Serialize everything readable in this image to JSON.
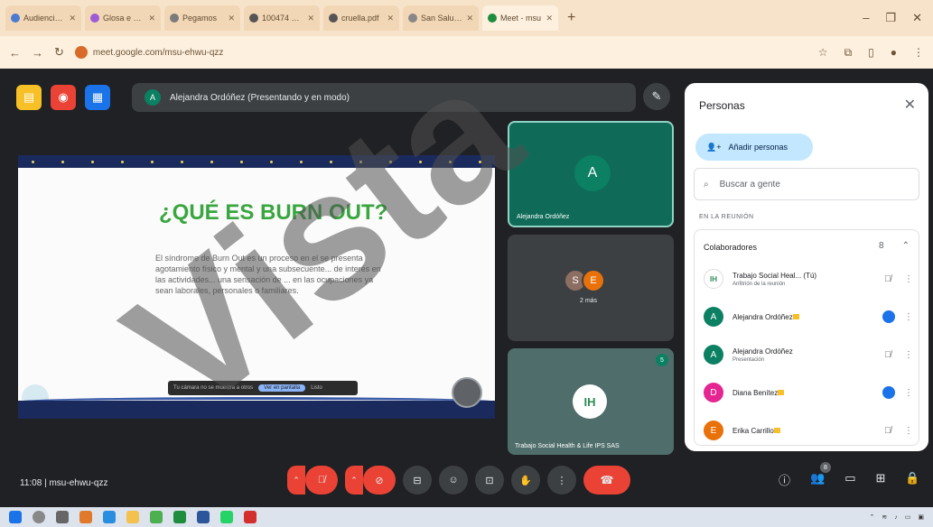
{
  "browser": {
    "tabs": [
      {
        "label": "Audiencia WP",
        "color": "#4a7bd1"
      },
      {
        "label": "Glosa e & ojos",
        "color": "#9b5cd6"
      },
      {
        "label": "Pegamos",
        "color": "#7b7b7b"
      },
      {
        "label": "100474 89878",
        "color": "#555"
      },
      {
        "label": "cruella.pdf",
        "color": "#555"
      },
      {
        "label": "San Salud IPS",
        "color": "#888"
      },
      {
        "label": "Meet - msu",
        "color": "#1e8e3e"
      }
    ],
    "url": "meet.google.com/msu-ehwu-qzz"
  },
  "meet": {
    "presenter_label": "Alejandra Ordóñez (Presentando y en modo)",
    "presenter_initial": "A",
    "slide": {
      "title": "¿QUÉ ES BURN OUT?",
      "body": "El síndrome de Burn Out es un proceso en el se presenta agotamiento físico y mental y una subsecuente... de interés en las actividades... una sensación de ... en las ocupaciones ya sean laborales, personales o familiares.",
      "caption_text": "Tu cámara no se muestra a otros",
      "caption_cta": "Ver en pantalla",
      "caption_extra": "Listo"
    },
    "tiles": {
      "tile1_initial": "A",
      "tile1_name": "Alejandra Ordóñez",
      "tile2_initials": [
        "S",
        "E"
      ],
      "tile2_label": "2 más",
      "tile3_logo": "IH",
      "tile3_name": "Trabajo Social Health & Life IPS SAS",
      "tile3_badge": "5"
    },
    "time": "11:08",
    "meeting_code": "msu-ehwu-qzz",
    "people_count": "8"
  },
  "panel": {
    "title": "Personas",
    "add_label": "Añadir personas",
    "search_placeholder": "Buscar a gente",
    "section_label": "EN LA REUNIÓN",
    "group_label": "Colaboradores",
    "group_count": "8",
    "people": [
      {
        "name": "Trabajo Social Heal... (Tú)",
        "sub": "Anfitrión de la reunión",
        "initial": "IH",
        "color": "#ffffff"
      },
      {
        "name": "Alejandra Ordóñez",
        "sub": "",
        "initial": "A",
        "color": "#0b8062"
      },
      {
        "name": "Alejandra Ordóñez",
        "sub": "Presentación",
        "initial": "A",
        "color": "#0b8062"
      },
      {
        "name": "Diana Benítez",
        "sub": "",
        "initial": "D",
        "color": "#e52592"
      },
      {
        "name": "Erika Carrillo",
        "sub": "",
        "initial": "E",
        "color": "#e8710a"
      }
    ]
  },
  "watermark": "Vista"
}
